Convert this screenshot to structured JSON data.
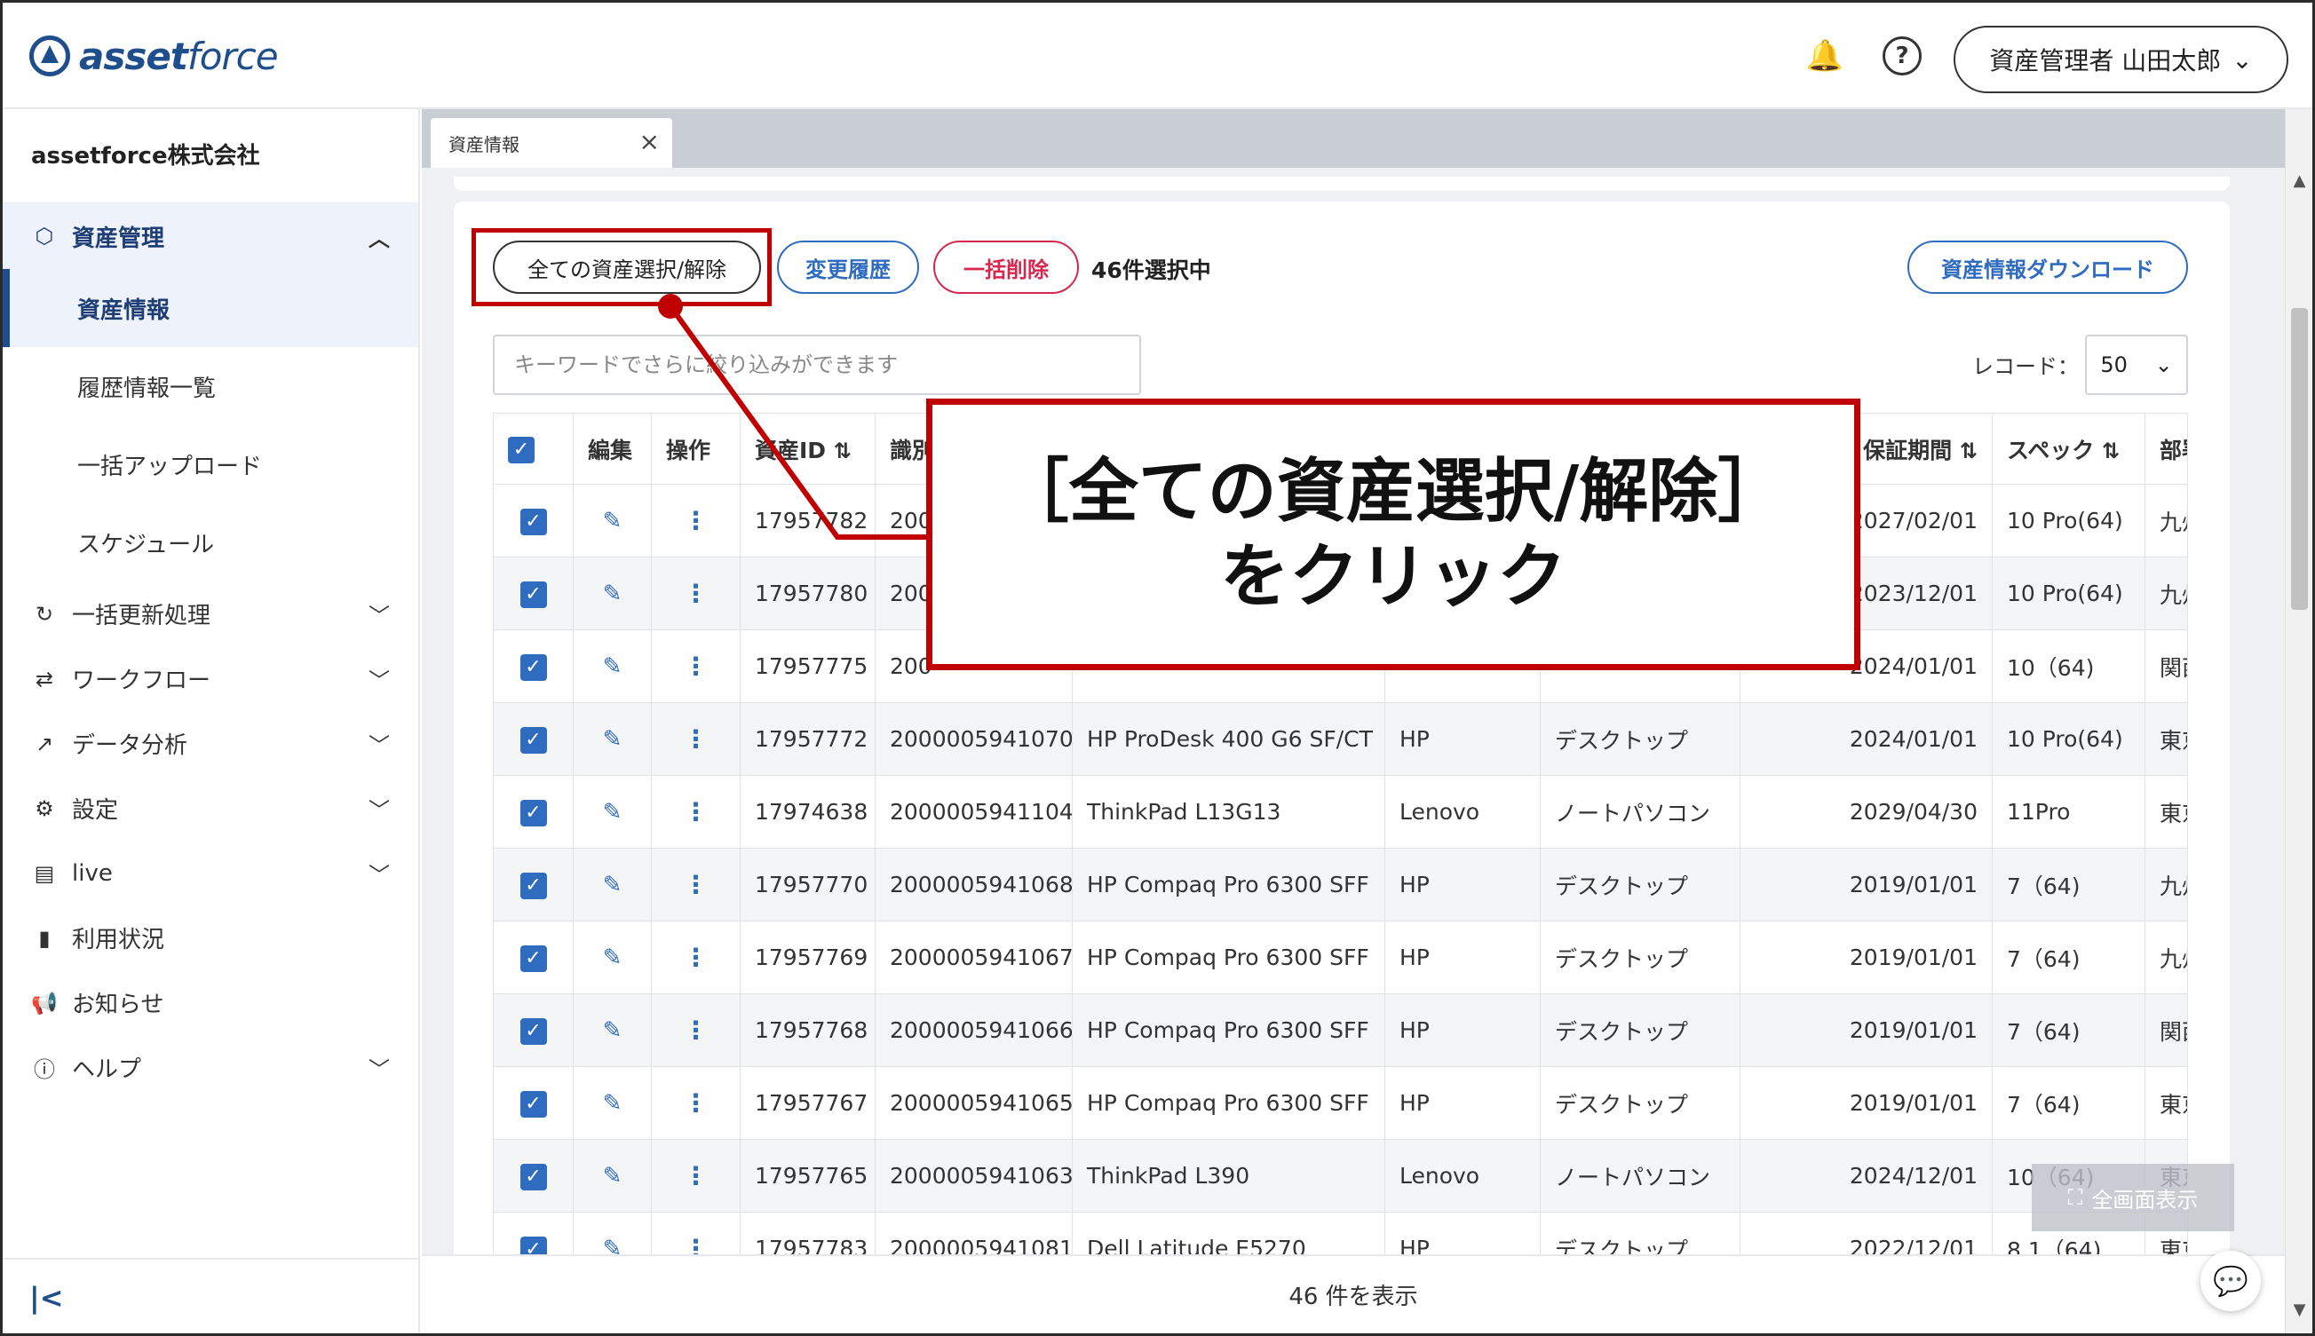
{
  "header": {
    "logo_text_bold": "asset",
    "logo_text_light": "force",
    "user_label": "資産管理者 山田太郎",
    "bell_icon": "bell-icon",
    "help_icon": "help-circle-icon"
  },
  "sidebar": {
    "company": "assetforce株式会社",
    "groups": [
      {
        "label": "資産管理",
        "icon": "cube-icon",
        "expanded": true
      },
      {
        "label": "一括更新処理",
        "icon": "refresh-icon"
      },
      {
        "label": "ワークフロー",
        "icon": "workflow-icon"
      },
      {
        "label": "データ分析",
        "icon": "analytics-icon"
      },
      {
        "label": "設定",
        "icon": "gear-icon"
      },
      {
        "label": "live",
        "icon": "live-icon"
      },
      {
        "label": "利用状況",
        "icon": "bar-chart-icon"
      },
      {
        "label": "お知らせ",
        "icon": "megaphone-icon"
      },
      {
        "label": "ヘルプ",
        "icon": "help-icon"
      }
    ],
    "subitems": [
      "資産情報",
      "履歴情報一覧",
      "一括アップロード",
      "スケジュール"
    ]
  },
  "tab": {
    "label": "資産情報"
  },
  "toolbar": {
    "select_all": "全ての資産選択/解除",
    "history": "変更履歴",
    "bulk_delete": "一括削除",
    "selected_count": "46件選択中",
    "download": "資産情報ダウンロード"
  },
  "search": {
    "placeholder": "キーワードでさらに絞り込みができます"
  },
  "record": {
    "label": "レコード：",
    "value": "50"
  },
  "table": {
    "headers": [
      "編集",
      "操作",
      "資産ID",
      "識別",
      "",
      "",
      "",
      "保証期間",
      "スペック",
      "部署"
    ],
    "rows": [
      [
        "17957782",
        "200",
        "",
        "",
        "",
        "2027/02/01",
        "10 Pro(64)",
        "九州"
      ],
      [
        "17957780",
        "200",
        "",
        "",
        "",
        "2023/12/01",
        "10 Pro(64)",
        "九州"
      ],
      [
        "17957775",
        "200",
        "",
        "",
        "",
        "2024/01/01",
        "10（64)",
        "関西"
      ],
      [
        "17957772",
        "2000005941070",
        "HP ProDesk 400 G6 SF/CT",
        "HP",
        "デスクトップ",
        "2024/01/01",
        "10 Pro(64)",
        "東京"
      ],
      [
        "17974638",
        "2000005941104",
        "ThinkPad L13G13",
        "Lenovo",
        "ノートパソコン",
        "2029/04/30",
        "11Pro",
        "東京"
      ],
      [
        "17957770",
        "2000005941068",
        "HP Compaq Pro 6300 SFF",
        "HP",
        "デスクトップ",
        "2019/01/01",
        "7（64)",
        "九州"
      ],
      [
        "17957769",
        "2000005941067",
        "HP Compaq Pro 6300 SFF",
        "HP",
        "デスクトップ",
        "2019/01/01",
        "7（64)",
        "九州"
      ],
      [
        "17957768",
        "2000005941066",
        "HP Compaq Pro 6300 SFF",
        "HP",
        "デスクトップ",
        "2019/01/01",
        "7（64)",
        "関西"
      ],
      [
        "17957767",
        "2000005941065",
        "HP Compaq Pro 6300 SFF",
        "HP",
        "デスクトップ",
        "2019/01/01",
        "7（64)",
        "東京"
      ],
      [
        "17957765",
        "2000005941063",
        "ThinkPad L390",
        "Lenovo",
        "ノートパソコン",
        "2024/12/01",
        "10（64)",
        "東京"
      ],
      [
        "17957783",
        "2000005941081",
        "Dell Latitude E5270",
        "HP",
        "デスクトップ",
        "2022/12/01",
        "8.1（64)",
        "東京"
      ]
    ]
  },
  "footer": {
    "count_text": "46 件を表示",
    "fullscreen": "全画面表示"
  },
  "annotation": {
    "line1": "［全ての資産選択/解除］",
    "line2": "をクリック",
    "color": "#c00000"
  }
}
